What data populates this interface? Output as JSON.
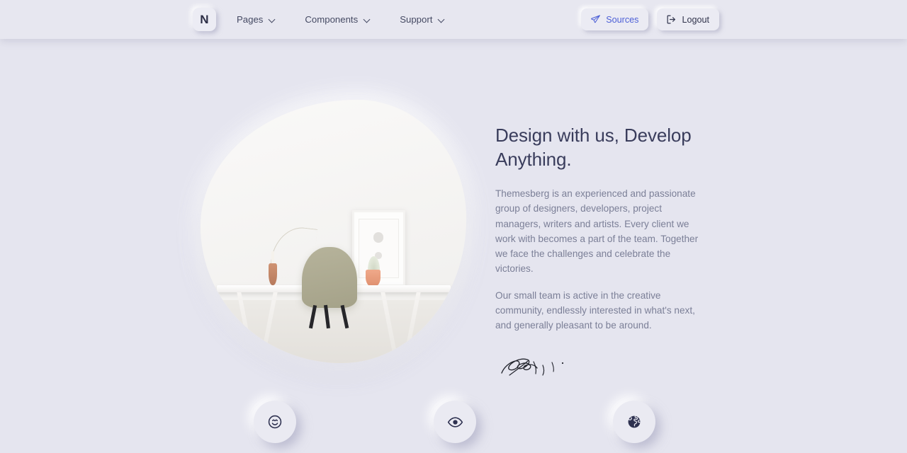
{
  "navbar": {
    "logo_text": "N",
    "links": [
      {
        "label": "Pages",
        "icon": "chevron-down-icon"
      },
      {
        "label": "Components",
        "icon": "chevron-down-icon"
      },
      {
        "label": "Support",
        "icon": "chevron-down-icon"
      }
    ],
    "actions": [
      {
        "label": "Sources",
        "icon": "paper-plane-icon",
        "color": "#4c5fd7"
      },
      {
        "label": "Logout",
        "icon": "sign-out-icon",
        "color": "#31344c"
      }
    ]
  },
  "hero": {
    "image_alt": "Minimalist white workspace with olive chair, desk, picture frame and plants",
    "headline": "Design with us, Develop Anything.",
    "paragraph_1": "Themesberg is an experienced and passionate group of designers, developers, project managers, writers and artists. Every client we work with becomes a part of the team. Together we face the challenges and celebrate the victories.",
    "paragraph_2": "Our small team is active in the creative community, endlessly interested in what's next, and generally pleasant to be around.",
    "signature_alt": "Handwritten signature"
  },
  "feature_icons": [
    {
      "name": "smile-icon"
    },
    {
      "name": "eye-icon"
    },
    {
      "name": "globe-icon"
    }
  ],
  "colors": {
    "background": "#e5e5ef",
    "navbar": "#e7e7f0",
    "heading": "#3a3d5c",
    "body_text": "#7b7f97",
    "accent": "#4c5fd7",
    "icon_dark": "#2e3150"
  }
}
